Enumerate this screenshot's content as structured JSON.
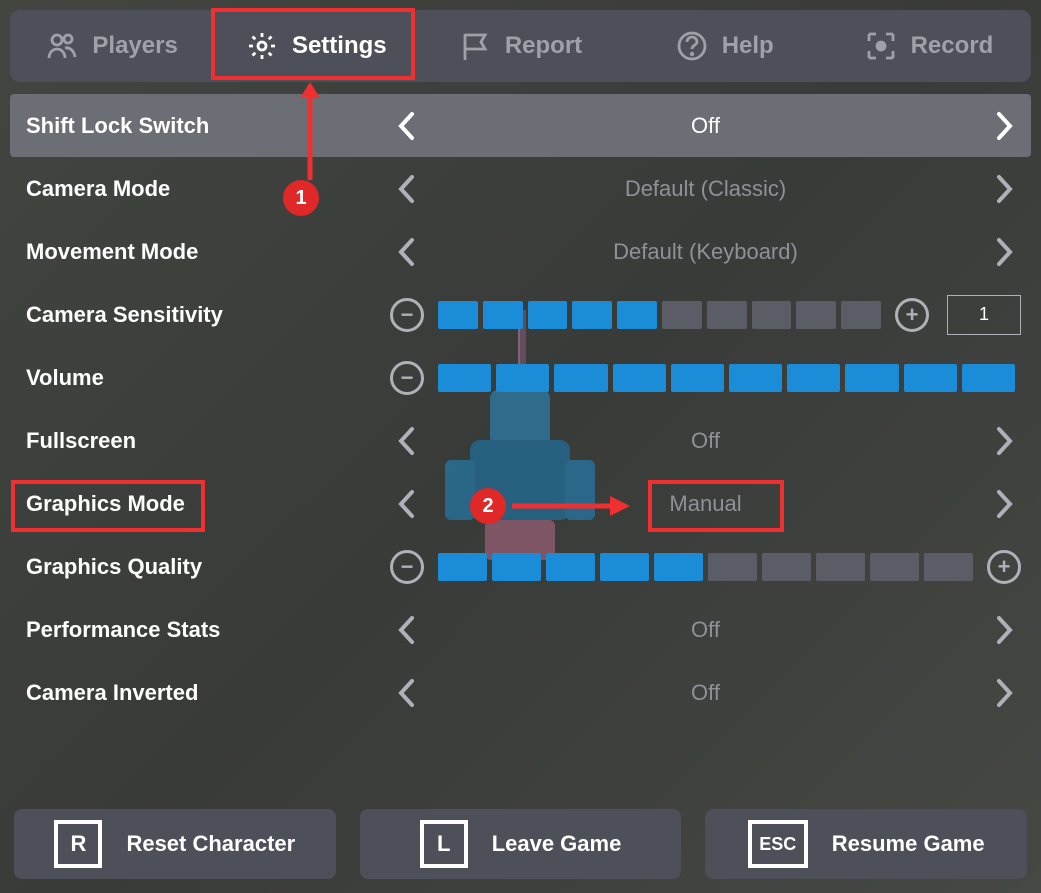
{
  "tabs": {
    "players": "Players",
    "settings": "Settings",
    "report": "Report",
    "help": "Help",
    "record": "Record"
  },
  "settings": {
    "shift_lock": {
      "label": "Shift Lock Switch",
      "value": "Off"
    },
    "camera_mode": {
      "label": "Camera Mode",
      "value": "Default (Classic)"
    },
    "movement_mode": {
      "label": "Movement Mode",
      "value": "Default (Keyboard)"
    },
    "camera_sensitivity": {
      "label": "Camera Sensitivity",
      "filled": 5,
      "total": 10,
      "numeric": "1"
    },
    "volume": {
      "label": "Volume",
      "filled": 10,
      "total": 10
    },
    "fullscreen": {
      "label": "Fullscreen",
      "value": "Off"
    },
    "graphics_mode": {
      "label": "Graphics Mode",
      "value": "Manual"
    },
    "graphics_quality": {
      "label": "Graphics Quality",
      "filled": 5,
      "total": 10
    },
    "performance_stats": {
      "label": "Performance Stats",
      "value": "Off"
    },
    "camera_inverted": {
      "label": "Camera Inverted",
      "value": "Off"
    }
  },
  "bottom": {
    "reset": {
      "key": "R",
      "label": "Reset Character"
    },
    "leave": {
      "key": "L",
      "label": "Leave Game"
    },
    "resume": {
      "key": "ESC",
      "label": "Resume Game"
    }
  },
  "annotations": {
    "marker1": "1",
    "marker2": "2"
  }
}
